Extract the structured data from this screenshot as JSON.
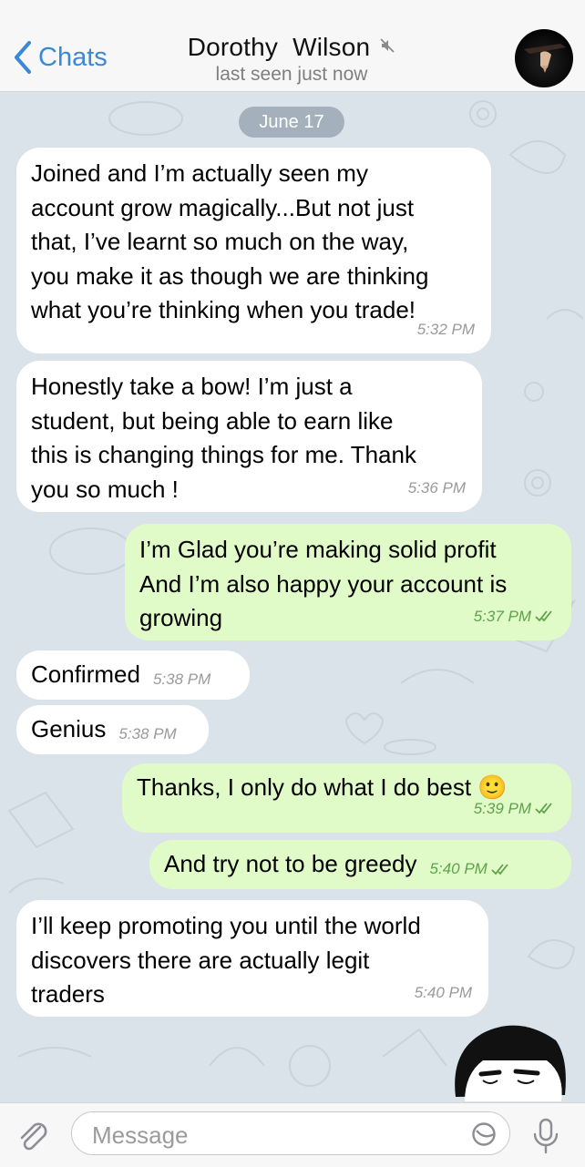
{
  "header": {
    "back_label": "Chats",
    "title": "Dorothy  Wilson",
    "status": "last seen just now"
  },
  "date_label": "June 17",
  "messages": [
    {
      "direction": "in",
      "lines": [
        "Joined and I’m actually seen my",
        "account grow magically...But not just",
        "that, I’ve learnt so much on the way,",
        "you make it as though we are thinking",
        "what you’re thinking when you trade!"
      ],
      "time": "5:32 PM"
    },
    {
      "direction": "in",
      "lines": [
        "Honestly take a bow! I’m just a",
        "student, but being able to earn like",
        "this is changing things for me. Thank",
        "you so much !"
      ],
      "time": "5:36 PM"
    },
    {
      "direction": "out",
      "lines": [
        "I’m Glad you’re making solid profit",
        "And I’m also happy your account is",
        "growing"
      ],
      "time": "5:37 PM",
      "read": true
    },
    {
      "direction": "in",
      "lines": [
        "Confirmed"
      ],
      "time": "5:38 PM"
    },
    {
      "direction": "in",
      "lines": [
        "Genius"
      ],
      "time": "5:38 PM"
    },
    {
      "direction": "out",
      "lines": [
        "Thanks, I only do what I do best 🙂"
      ],
      "time": "5:39 PM",
      "read": true
    },
    {
      "direction": "out",
      "lines": [
        "And try not to be greedy"
      ],
      "time": "5:40 PM",
      "read": true
    },
    {
      "direction": "in",
      "lines": [
        "I’ll keep promoting you until the world",
        "discovers there are actually legit",
        "traders"
      ],
      "time": "5:40 PM"
    }
  ],
  "composer": {
    "placeholder": "Message"
  },
  "colors": {
    "accent": "#3b88d8",
    "incoming_bubble": "#ffffff",
    "outgoing_bubble": "#e0fbc8",
    "wallpaper": "#dbe3ea",
    "read_check": "#5ea24b"
  },
  "icons": [
    "chevron-left-icon",
    "muted-speaker-icon",
    "attach-paperclip-icon",
    "sticker-icon",
    "microphone-icon",
    "double-check-icon",
    "smiley-emoji-icon"
  ]
}
